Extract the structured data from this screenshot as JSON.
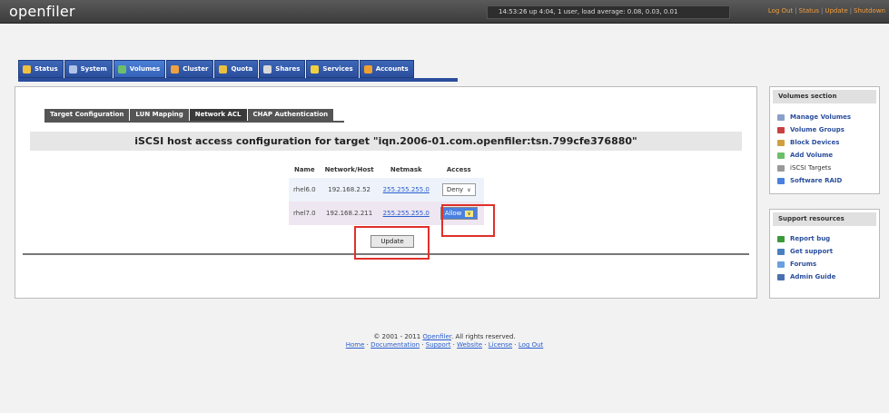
{
  "header": {
    "logo": "openfiler",
    "uptime": "14:53:26 up 4:04, 1 user, load average: 0.08, 0.03, 0.01",
    "links": [
      "Log Out",
      "Status",
      "Update",
      "Shutdown"
    ],
    "link_color": "#f39c3a"
  },
  "nav": {
    "tabs": [
      {
        "label": "Status",
        "icon": "status-icon",
        "color": "#f0c040"
      },
      {
        "label": "System",
        "icon": "system-icon",
        "color": "#b0c4e8"
      },
      {
        "label": "Volumes",
        "icon": "volumes-icon",
        "color": "#6bbf6b",
        "active": true
      },
      {
        "label": "Cluster",
        "icon": "cluster-icon",
        "color": "#f0a040"
      },
      {
        "label": "Quota",
        "icon": "quota-icon",
        "color": "#e8c040"
      },
      {
        "label": "Shares",
        "icon": "shares-icon",
        "color": "#d8d8d8"
      },
      {
        "label": "Services",
        "icon": "services-icon",
        "color": "#f0d040"
      },
      {
        "label": "Accounts",
        "icon": "accounts-icon",
        "color": "#f0a030"
      }
    ]
  },
  "subtabs": [
    "Target Configuration",
    "LUN Mapping",
    "Network ACL",
    "CHAP Authentication"
  ],
  "page_title": "iSCSI host access configuration for target \"iqn.2006-01.com.openfiler:tsn.799cfe376880\"",
  "acl_table": {
    "headers": [
      "Name",
      "Network/Host",
      "Netmask",
      "Access"
    ],
    "rows": [
      {
        "name": "rhel6.0",
        "host": "192.168.2.52",
        "netmask": "255.255.255.0",
        "access": "Deny"
      },
      {
        "name": "rhel7.0",
        "host": "192.168.2.211",
        "netmask": "255.255.255.0",
        "access": "Allow"
      }
    ]
  },
  "update_label": "Update",
  "volumes_section": {
    "title": "Volumes section",
    "items": [
      {
        "label": "Manage Volumes",
        "icon": "manage-volumes-icon",
        "color": "#8aa0c8"
      },
      {
        "label": "Volume Groups",
        "icon": "volume-groups-icon",
        "color": "#c84040"
      },
      {
        "label": "Block Devices",
        "icon": "block-devices-icon",
        "color": "#d0a040"
      },
      {
        "label": "Add Volume",
        "icon": "add-volume-icon",
        "color": "#6bbf6b"
      },
      {
        "label": "iSCSI Targets",
        "icon": "iscsi-targets-icon",
        "color": "#999999"
      },
      {
        "label": "Software RAID",
        "icon": "software-raid-icon",
        "color": "#4a80e0"
      }
    ]
  },
  "support_section": {
    "title": "Support resources",
    "items": [
      {
        "label": "Report bug",
        "icon": "report-bug-icon",
        "color": "#3a9a3a"
      },
      {
        "label": "Get support",
        "icon": "get-support-icon",
        "color": "#4a80c0"
      },
      {
        "label": "Forums",
        "icon": "forums-icon",
        "color": "#6aa0e0"
      },
      {
        "label": "Admin Guide",
        "icon": "admin-guide-icon",
        "color": "#4a70b0"
      }
    ]
  },
  "footer": {
    "copyright_prefix": "© 2001 - 2011",
    "copyright_link": "Openfiler",
    "copyright_suffix": ". All rights reserved.",
    "links": [
      "Home",
      "Documentation",
      "Support",
      "Website",
      "License",
      "Log Out"
    ]
  },
  "accent_colors": {
    "nav_blue": "#2a4e9c",
    "highlight_red": "#e0302a",
    "link_blue": "#2a5fd0"
  }
}
